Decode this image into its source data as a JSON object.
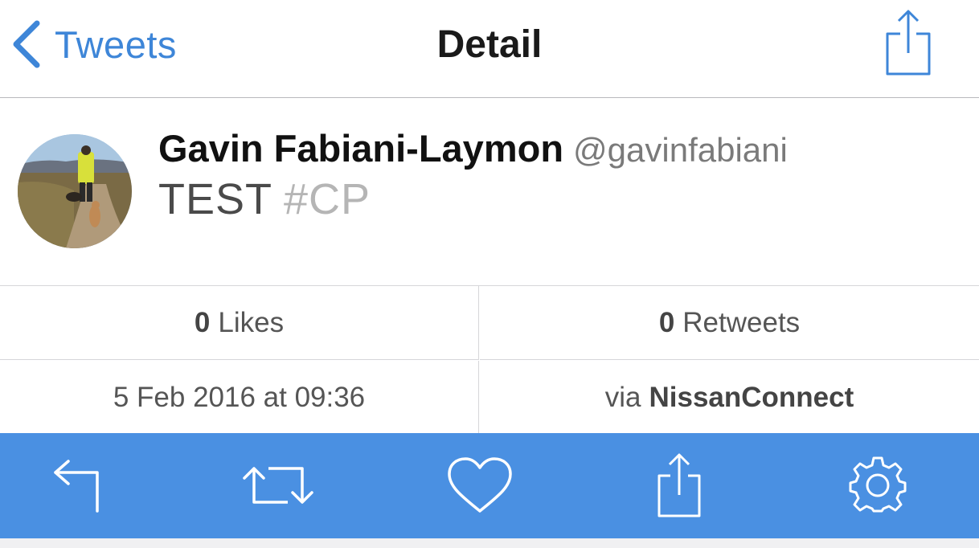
{
  "nav": {
    "back_label": "Tweets",
    "title": "Detail"
  },
  "tweet": {
    "user_name": "Gavin Fabiani-Laymon",
    "user_handle": "@gavinfabiani",
    "text": "TEST",
    "hashtag": "#CP"
  },
  "stats": {
    "likes_count": "0",
    "likes_label": "Likes",
    "retweets_count": "0",
    "retweets_label": "Retweets",
    "timestamp": "5 Feb 2016 at 09:36",
    "via_prefix": "via",
    "source": "NissanConnect"
  },
  "toolbar": {
    "icons": [
      "reply-icon",
      "retweet-icon",
      "like-icon",
      "share-icon",
      "settings-icon"
    ]
  },
  "colors": {
    "accent": "#3e86d8",
    "toolbar_bg": "#4a90e2",
    "hashtag": "#b5b5b5"
  }
}
